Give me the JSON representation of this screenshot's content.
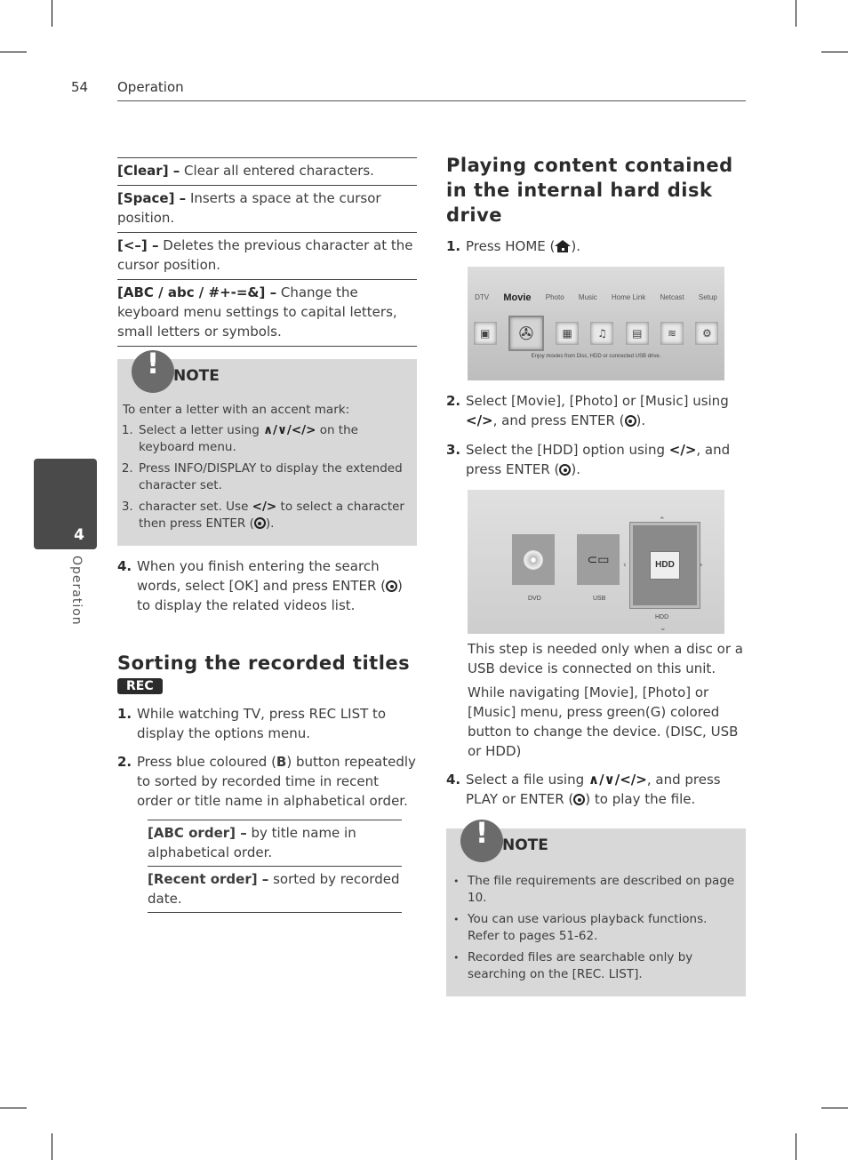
{
  "header": {
    "page_number": "54",
    "section": "Operation"
  },
  "side_tab": {
    "chapter_number": "4",
    "chapter_label": "Operation"
  },
  "left": {
    "keyboard_options": [
      {
        "term": "[Clear] –",
        "desc": " Clear all entered characters."
      },
      {
        "term": "[Space] –",
        "desc": " Inserts a space at the cursor position."
      },
      {
        "term": "[<–] –",
        "desc": " Deletes the previous character at the cursor position."
      },
      {
        "term": "[ABC / abc / #+-=&] –",
        "desc": " Change the keyboard menu settings to capital letters, small letters or symbols."
      }
    ],
    "note": {
      "title": "NOTE",
      "intro": "To enter a letter with an accent mark:",
      "items": [
        {
          "pre": "Select a letter using ",
          "arrows": "∧/∨/</>",
          "post": " on the keyboard menu."
        },
        {
          "pre": "Press INFO/DISPLAY to display the extended character set.",
          "arrows": "",
          "post": ""
        },
        {
          "pre": "character set. Use ",
          "arrows": "</>",
          "post": " to select a character then press ENTER (",
          "enter": true,
          "end": ")."
        }
      ]
    },
    "step4": {
      "num": "4.",
      "pre": "When you finish entering the search words, select [OK] and press ENTER (",
      "post": ") to display the related videos list."
    },
    "sorting": {
      "heading": "Sorting the recorded titles",
      "badge": "REC",
      "steps": [
        {
          "num": "1.",
          "text": "While watching TV, press REC LIST to display the options menu."
        },
        {
          "num": "2.",
          "pre": "Press blue coloured (",
          "bold": "B",
          "post": ") button repeatedly to sorted by recorded time in recent order or title name in alphabetical order."
        }
      ],
      "options": [
        {
          "term": "[ABC order] –",
          "desc": " by title name in alphabetical order."
        },
        {
          "term": "[Recent order] –",
          "desc": " sorted by recorded date."
        }
      ]
    }
  },
  "right": {
    "heading": "Playing content contained in the internal hard disk drive",
    "step1": {
      "num": "1.",
      "pre": "Press HOME (",
      "post": ")."
    },
    "home_menu": {
      "items": [
        "DTV",
        "Movie",
        "Photo",
        "Music",
        "Home Link",
        "Netcast",
        "Setup"
      ],
      "selected": "Movie",
      "caption": "Enjoy movies from Disc, HDD or connected USB drive."
    },
    "step2": {
      "num": "2.",
      "pre": "Select [Movie], [Photo] or [Music] using ",
      "arrows": "</>",
      "post": ", and press ENTER (",
      "end": ")."
    },
    "step3": {
      "num": "3.",
      "pre": "Select the [HDD] option using ",
      "arrows": "</>",
      "post": ", and press ENTER (",
      "end": ")."
    },
    "device_menu": {
      "devices": [
        "DVD",
        "USB",
        "HDD"
      ],
      "selected": "HDD",
      "selected_button": "HDD"
    },
    "info1": "This step is needed only when a disc or a USB device is connected on this unit.",
    "info2": "While navigating [Movie], [Photo] or [Music] menu, press green(G) colored button to change the device. (DISC, USB or HDD)",
    "step4": {
      "num": "4.",
      "pre": "Select a file using ",
      "arrows": "∧/∨/</>",
      "post": ", and press PLAY or ENTER (",
      "end": ") to play the file."
    },
    "note": {
      "title": "NOTE",
      "items": [
        "The file requirements are described on page 10.",
        "You can use various playback functions. Refer to pages 51-62.",
        "Recorded files are searchable only by searching on the [REC. LIST]."
      ]
    }
  }
}
